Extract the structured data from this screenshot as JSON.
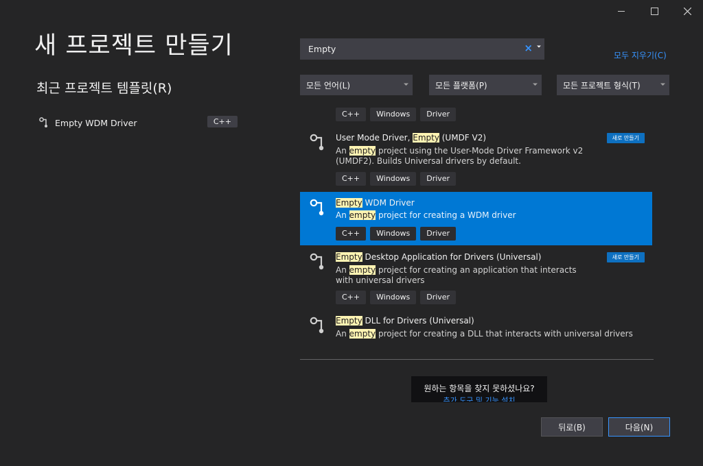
{
  "window": {
    "controls": [
      "minimize-icon",
      "maximize-icon",
      "close-icon"
    ]
  },
  "page_title": "새 프로젝트 만들기",
  "recent": {
    "title": "최근 프로젝트 템플릿(R)",
    "items": [
      {
        "name": "Empty WDM Driver",
        "language": "C++",
        "icon": "driver-icon"
      }
    ]
  },
  "search": {
    "value": "Empty",
    "clear_glyph": "×",
    "clear_all_label": "모두 지우기(C)"
  },
  "filters": {
    "language": "모든 언어(L)",
    "platform": "모든 플랫폼(P)",
    "project_type": "모든 프로젝트 형식(T)"
  },
  "highlight_color": "#fff4b3",
  "accent_color": "#0078d4",
  "results": [
    {
      "tags": [
        "C++",
        "Windows",
        "Driver"
      ]
    },
    {
      "name_parts": [
        "User Mode Driver, ",
        "Empty",
        " (UMDF V2)"
      ],
      "desc_parts": [
        "An ",
        "empty",
        " project using the User-Mode Driver Framework v2 (UMDF2). Builds Universal drivers by default."
      ],
      "badge": "새로 만들기",
      "tags": [
        "C++",
        "Windows",
        "Driver"
      ]
    },
    {
      "name_parts": [
        "",
        "Empty",
        " WDM Driver"
      ],
      "desc_parts": [
        "An ",
        "empty",
        " project for creating a WDM driver"
      ],
      "selected": true,
      "tags": [
        "C++",
        "Windows",
        "Driver"
      ]
    },
    {
      "name_parts": [
        "",
        "Empty",
        " Desktop Application for Drivers (Universal)"
      ],
      "desc_parts": [
        "An ",
        "empty",
        " project for creating an application that interacts with universal drivers"
      ],
      "badge": "새로 만들기",
      "tags": [
        "C++",
        "Windows",
        "Driver"
      ]
    },
    {
      "name_parts": [
        "",
        "Empty",
        " DLL for Drivers (Universal)"
      ],
      "desc_parts": [
        "An ",
        "empty",
        " project for creating a DLL that interacts with universal drivers"
      ]
    }
  ],
  "not_found": {
    "question": "원하는 항목을 찾지 못하셨나요?",
    "link": "추가 도구 및 기능 설치"
  },
  "buttons": {
    "back": "뒤로(B)",
    "next": "다음(N)"
  }
}
